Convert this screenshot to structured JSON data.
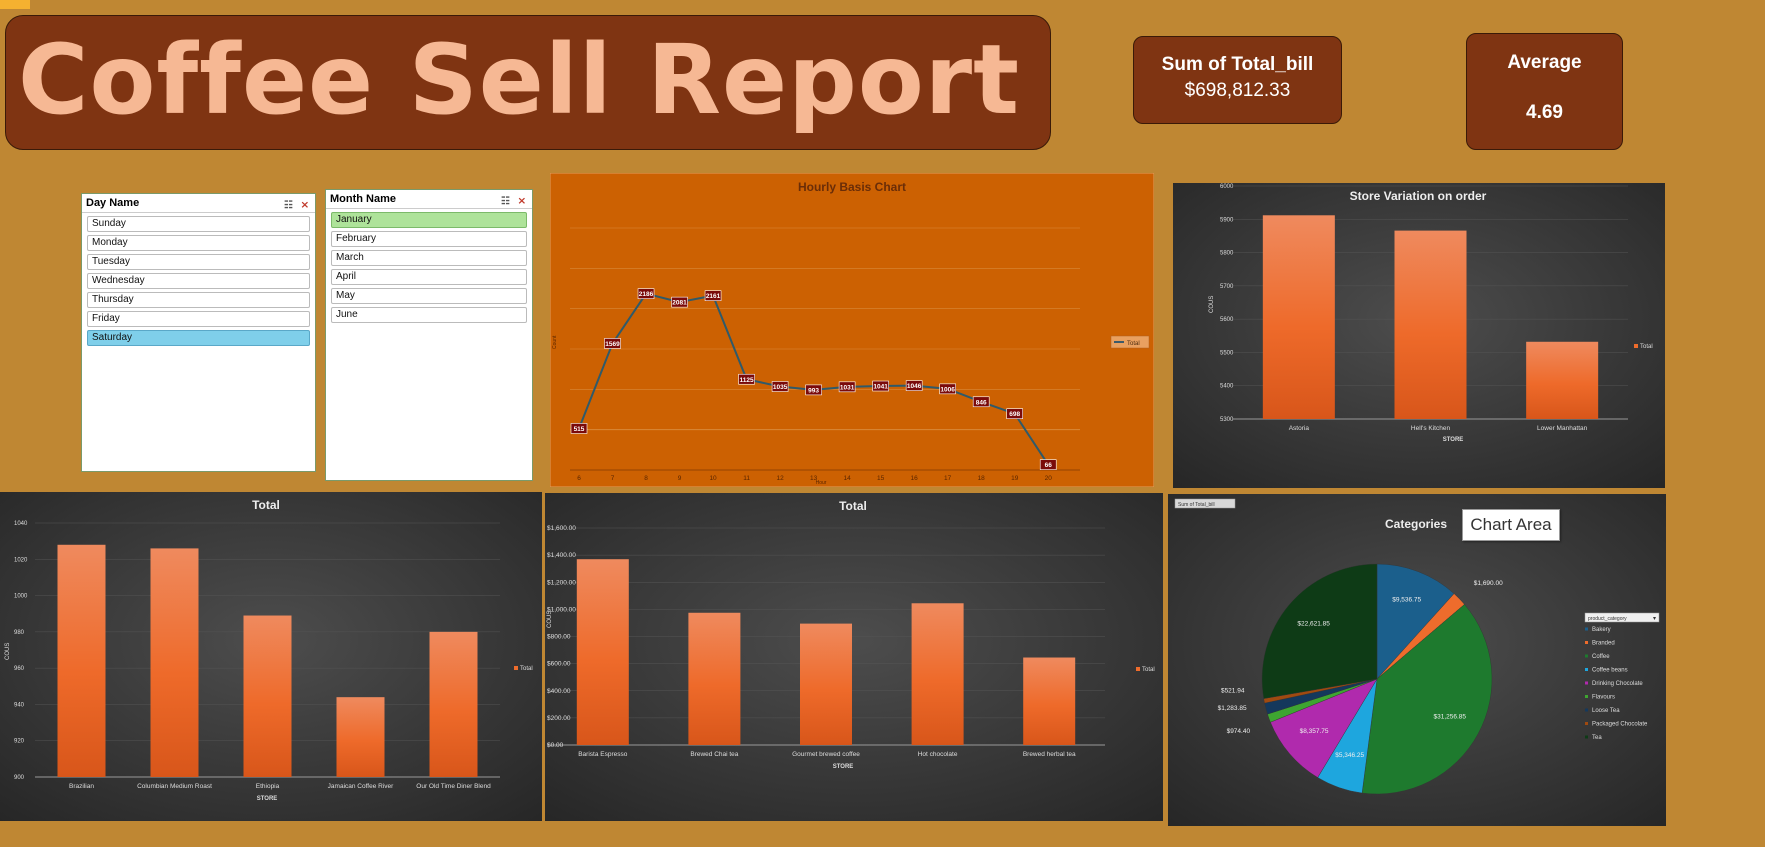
{
  "report": {
    "title": "Coffee Sell Report"
  },
  "kpis": [
    {
      "label": "Sum of Total_bill",
      "value": "$698,812.33"
    },
    {
      "label": "Average",
      "value": "4.69"
    }
  ],
  "slicers": {
    "day": {
      "title": "Day Name",
      "items": [
        "Sunday",
        "Monday",
        "Tuesday",
        "Wednesday",
        "Thursday",
        "Friday",
        "Saturday"
      ],
      "selected": "Saturday"
    },
    "month": {
      "title": "Month Name",
      "items": [
        "January",
        "February",
        "March",
        "April",
        "May",
        "June"
      ],
      "selected": "January"
    }
  },
  "colors": {
    "background": "#BF8733",
    "title_box": "#7F3412",
    "title_text": "#F6B894",
    "bar": "#EE6C2C",
    "line_panel": "#CC6102",
    "dark_panel": "#3a3a3a"
  },
  "tooltip": {
    "chart_area": "Chart Area"
  },
  "chart_data": [
    {
      "id": "hourly",
      "type": "line",
      "title": "Hourly Basis Chart",
      "xlabel": "Hour",
      "ylabel": "Count",
      "legend": "Total",
      "x": [
        "6",
        "7",
        "8",
        "9",
        "10",
        "11",
        "12",
        "13",
        "14",
        "15",
        "16",
        "17",
        "18",
        "19",
        "20"
      ],
      "values": [
        515,
        1569,
        2186,
        2081,
        2161,
        1125,
        1035,
        993,
        1031,
        1041,
        1046,
        1006,
        846,
        698,
        66
      ],
      "ylim": [
        0,
        3000
      ],
      "grid": true
    },
    {
      "id": "store",
      "type": "bar",
      "title": "Store Variation on order",
      "xlabel": "STORE",
      "ylabel": "COUS",
      "legend": "Total",
      "categories": [
        "Astoria",
        "Hell's Kitchen",
        "Lower Manhattan"
      ],
      "values": [
        5912,
        5866,
        5532
      ],
      "yticks": [
        "5300",
        "5400",
        "5500",
        "5600",
        "5700",
        "5800",
        "5900",
        "6000"
      ],
      "ylim": [
        5300,
        6000
      ],
      "grid": true
    },
    {
      "id": "beans",
      "type": "bar",
      "title": "Total",
      "xlabel": "STORE",
      "ylabel": "COUS",
      "legend": "Total",
      "categories": [
        "Brazilian",
        "Columbian Medium Roast",
        "Ethiopia",
        "Jamaican Coffee River",
        "Our Old Time Diner Blend"
      ],
      "values": [
        1028,
        1026,
        989,
        944,
        980
      ],
      "yticks": [
        "900",
        "920",
        "940",
        "960",
        "980",
        "1000",
        "1020",
        "1040"
      ],
      "ylim": [
        900,
        1040
      ],
      "grid": true
    },
    {
      "id": "drinks",
      "type": "bar",
      "title": "Total",
      "xlabel": "STORE",
      "ylabel": "COUS",
      "legend": "Total",
      "categories": [
        "Barista Espresso",
        "Brewed Chai tea",
        "Gourmet brewed coffee",
        "Hot chocolate",
        "Brewed herbal tea"
      ],
      "values": [
        1370,
        975,
        895,
        1045,
        645
      ],
      "yticks": [
        "$0.00",
        "$200.00",
        "$400.00",
        "$600.00",
        "$800.00",
        "$1,000.00",
        "$1,200.00",
        "$1,400.00",
        "$1,600.00"
      ],
      "ylim": [
        0,
        1600
      ],
      "grid": true
    },
    {
      "id": "categories",
      "type": "pie",
      "title": "Categories",
      "field_button": "Sum of Total_bill",
      "filter_label": "product_category",
      "labels": [
        "Bakery",
        "Branded",
        "Coffee",
        "Coffee beans",
        "Drinking Chocolate",
        "Flavours",
        "Loose Tea",
        "Packaged Chocolate",
        "Tea"
      ],
      "values": [
        9536.75,
        1690.0,
        31256.85,
        5346.25,
        8357.75,
        974.4,
        1283.85,
        521.94,
        22621.85
      ],
      "value_labels": [
        "$9,536.75",
        "$1,690.00",
        "$31,256.85",
        "$5,346.25",
        "$8,357.75",
        "$974.40",
        "$1,283.85",
        "$521.94",
        "$22,621.85"
      ],
      "slice_colors": [
        "#1B5F8C",
        "#EE6C2C",
        "#1E7A2E",
        "#1EA6DE",
        "#B02AAD",
        "#3EA531",
        "#14385C",
        "#A04A10",
        "#0E3B16"
      ]
    }
  ]
}
